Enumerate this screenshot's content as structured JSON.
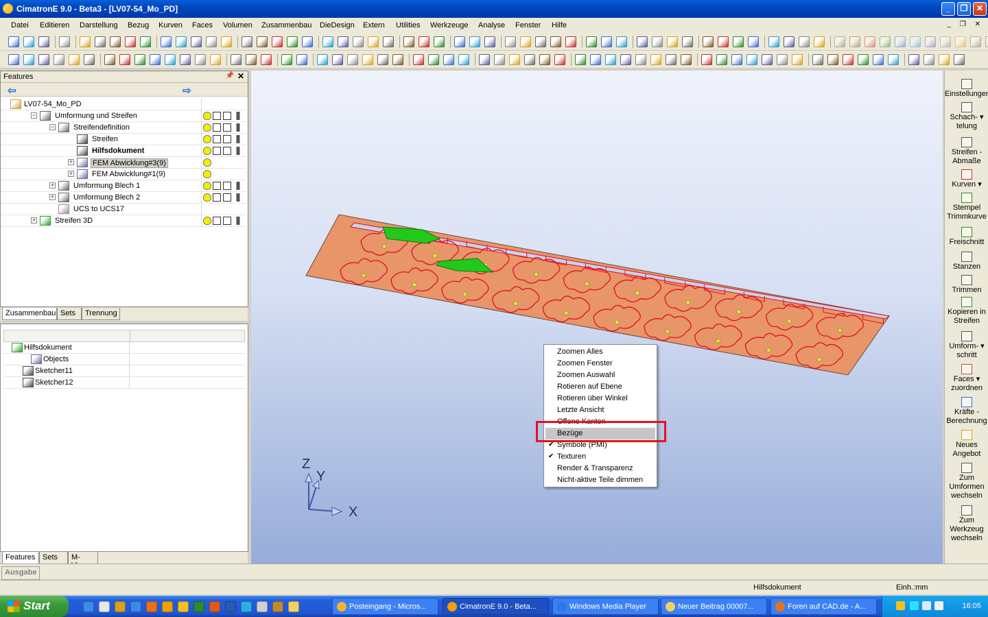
{
  "window": {
    "title": "CimatronE 9.0 - Beta3 - [LV07-54_Mo_PD]"
  },
  "menubar": {
    "items": [
      "Datei",
      "Editieren",
      "Darstellung",
      "Bezug",
      "Kurven",
      "Faces",
      "Volumen",
      "Zusammenbau",
      "DieDesign",
      "Extern",
      "Utilities",
      "Werkzeuge",
      "Analyse",
      "Fenster",
      "Hilfe"
    ]
  },
  "features_panel": {
    "title": "Features",
    "tree": [
      {
        "label": "LV07-54_Mo_PD",
        "indent": 0,
        "expander": "",
        "icons": false
      },
      {
        "label": "Umformung und Streifen",
        "indent": 1,
        "expander": "−",
        "icons": true
      },
      {
        "label": "Streifendefinition",
        "indent": 2,
        "expander": "−",
        "icons": true
      },
      {
        "label": "Streifen",
        "indent": 3,
        "expander": "",
        "icons": true
      },
      {
        "label": "Hilfsdokument",
        "indent": 3,
        "expander": "",
        "icons": true,
        "bold": true
      },
      {
        "label": "FEM Abwicklung#3(9)",
        "indent": 3,
        "expander": "+",
        "icons": "bulb",
        "selected": true
      },
      {
        "label": "FEM Abwicklung#1(9)",
        "indent": 3,
        "expander": "+",
        "icons": "bulb"
      },
      {
        "label": "Umformung Blech 1",
        "indent": 2,
        "expander": "+",
        "icons": true
      },
      {
        "label": "Umformung Blech 2",
        "indent": 2,
        "expander": "+",
        "icons": true
      },
      {
        "label": "UCS to UCS17",
        "indent": 2,
        "expander": "",
        "icons": false
      },
      {
        "label": "Streifen 3D",
        "indent": 1,
        "expander": "+",
        "icons": true
      }
    ],
    "tabs": [
      "Zusammenbau",
      "Sets",
      "Trennung"
    ]
  },
  "props_panel": {
    "rows": [
      "Hilfsdokument",
      "Objects",
      "Sketcher11",
      "Sketcher12"
    ],
    "tabs": [
      "Features",
      "Sets",
      "M-View"
    ]
  },
  "output": {
    "tab": "Ausgabe"
  },
  "viewport": {
    "axes": {
      "z": "Z",
      "y": "Y",
      "x": "X"
    },
    "strip_color": "#e8956a",
    "cut_color": "#e0101a",
    "highlight_color": "#22c81a",
    "background_top": "#eff2fb",
    "background_bottom": "#97acd9"
  },
  "context_menu": {
    "items": [
      {
        "label": "Zoomen Alles",
        "check": ""
      },
      {
        "label": "Zoomen Fenster",
        "check": ""
      },
      {
        "label": "Zoomen Auswahl",
        "check": ""
      },
      {
        "label": "Rotieren auf Ebene",
        "check": ""
      },
      {
        "label": "Rotieren über Winkel",
        "check": ""
      },
      {
        "label": "Letzte Ansicht",
        "check": ""
      },
      {
        "label": "Offene Kanten",
        "check": ""
      },
      {
        "label": "Bezüge",
        "check": "",
        "highlighted": true
      },
      {
        "label": "Symbole (PMI)",
        "check": "✔"
      },
      {
        "label": "Texturen",
        "check": "✔"
      },
      {
        "label": "Render & Transparenz",
        "check": ""
      },
      {
        "label": "Nicht-aktive Teile dimmen",
        "check": ""
      }
    ]
  },
  "right_palette": [
    {
      "label": "Einstellungen"
    },
    {
      "label": "Schach- ▾\ntelung"
    },
    {
      "label": "Streifen -\nAbmaße"
    },
    {
      "label": "Kurven ▾"
    },
    {
      "label": "Stempel\nTrimmkurve"
    },
    {
      "label": "Freischnitt"
    },
    {
      "label": "Stanzen"
    },
    {
      "label": "Trimmen"
    },
    {
      "label": "Kopieren in\nStreifen"
    },
    {
      "label": "Umform- ▾\nschritt"
    },
    {
      "label": "Faces ▾\nzuordnen"
    },
    {
      "label": "Kräfte -\nBerechnung"
    },
    {
      "label": "Neues\nAngebot"
    },
    {
      "label": "Zum\nUmformen\nwechseln"
    },
    {
      "label": "Zum\nWerkzeug\nwechseln"
    }
  ],
  "statusbar": {
    "document": "Hilfsdokument",
    "units": "Einh.:mm"
  },
  "taskbar": {
    "start_label": "Start",
    "tasks": [
      {
        "label": "Posteingang - Micros...",
        "color": "#f2b42e"
      },
      {
        "label": "CimatronE 9.0 - Beta...",
        "color": "#f0a000",
        "active": true
      },
      {
        "label": "Windows Media Player",
        "color": "#2a78e4"
      },
      {
        "label": "Neuer Beitrag 00007...",
        "color": "#f2d060"
      },
      {
        "label": "Foren auf CAD.de - A...",
        "color": "#e8721a"
      }
    ],
    "clock": "16:05"
  }
}
